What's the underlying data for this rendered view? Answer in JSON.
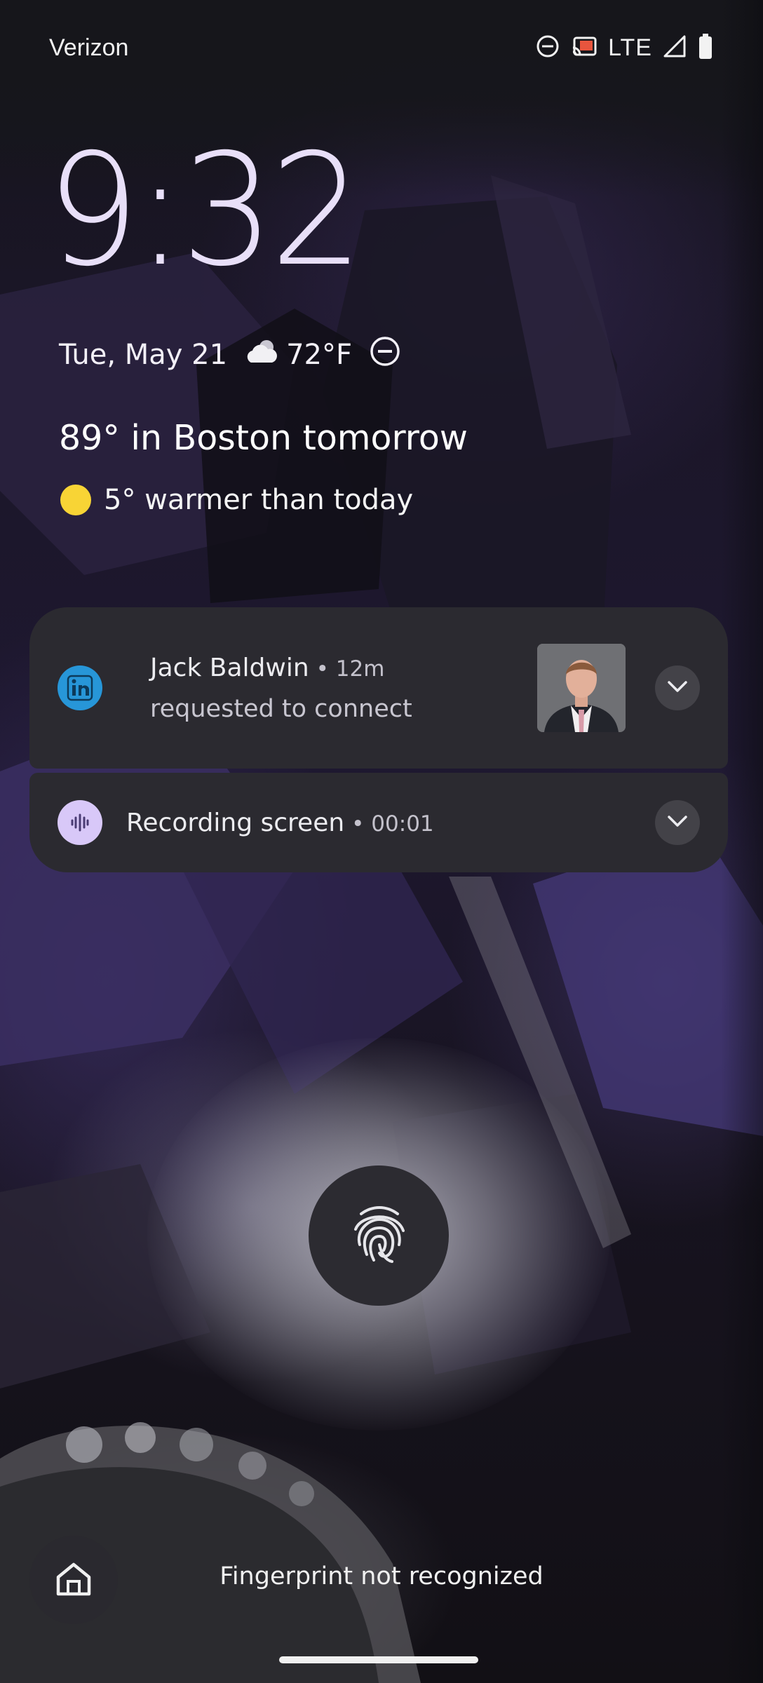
{
  "status_bar": {
    "carrier": "Verizon",
    "network": "LTE",
    "icons": [
      "do-not-disturb-icon",
      "cast-icon",
      "cell-signal-icon",
      "battery-icon"
    ]
  },
  "lockscreen": {
    "time": "9:32",
    "date": "Tue, May 21",
    "weather_icon": "partly-cloudy-icon",
    "temperature": "72°F",
    "dnd_icon": "do-not-disturb-icon",
    "forecast": "89° in Boston tomorrow",
    "forecast_detail": "5° warmer than today"
  },
  "notifications": [
    {
      "app_icon": "linkedin-icon",
      "title": "Jack Baldwin",
      "time": "• 12m",
      "text": "requested to connect",
      "has_thumbnail": true
    },
    {
      "app_icon": "recorder-icon",
      "title": "Recording screen",
      "time": "• 00:01"
    }
  ],
  "bottom": {
    "message": "Fingerprint not recognized",
    "home_icon": "home-icon"
  },
  "colors": {
    "clock": "#e8dff8",
    "notification_bg": "#2b2a30",
    "linkedin": "#2796d8",
    "recorder": "#d8c8f8",
    "sun": "#f8d435"
  }
}
